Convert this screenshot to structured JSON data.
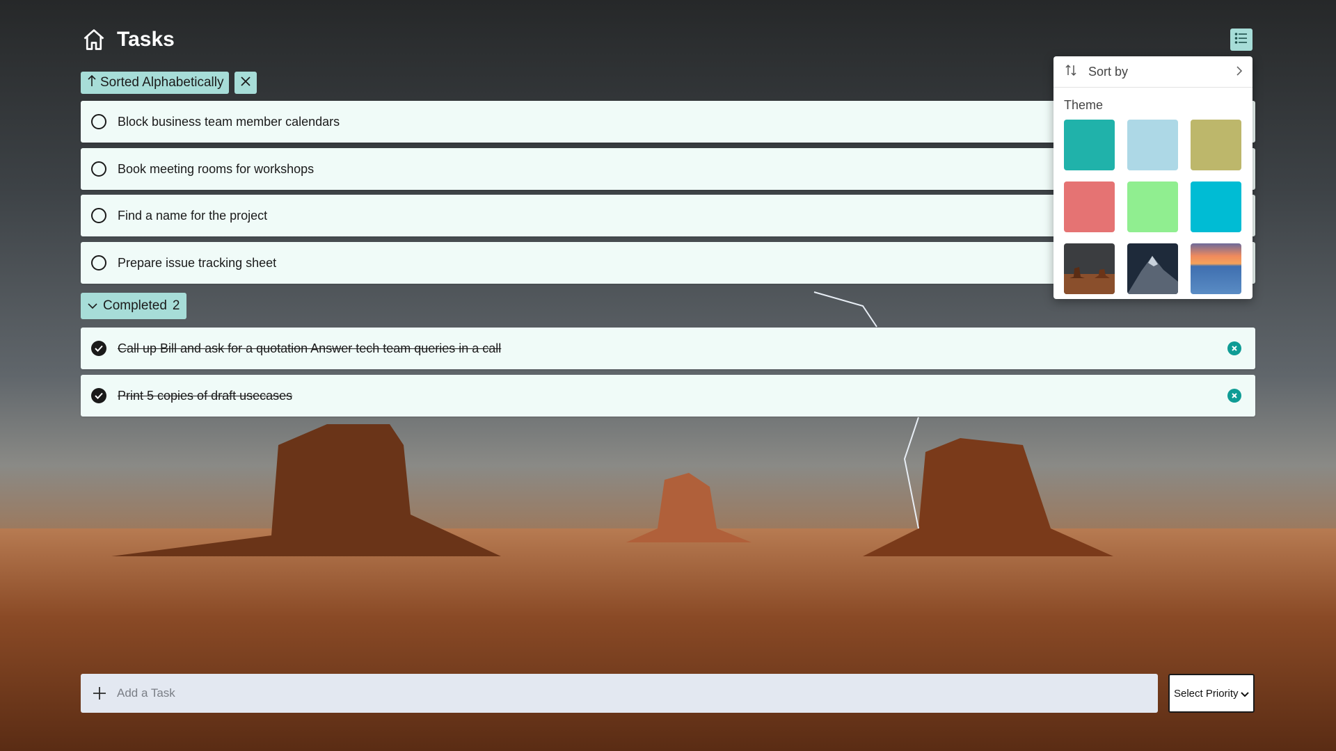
{
  "app": {
    "title": "Tasks"
  },
  "sort": {
    "label": "Sorted Alphabetically"
  },
  "tasks": [
    {
      "label": "Block business team member calendars"
    },
    {
      "label": "Book meeting rooms for workshops"
    },
    {
      "label": "Find a name for the project"
    },
    {
      "label": "Prepare issue tracking sheet"
    }
  ],
  "completed": {
    "label": "Completed",
    "count": "2",
    "items": [
      {
        "label": "Call up Bill and ask for a quotation Answer tech team queries in a call"
      },
      {
        "label": "Print 5 copies of draft usecases"
      }
    ]
  },
  "menu": {
    "sort_by": "Sort by",
    "theme_label": "Theme",
    "theme_colors": [
      "#20b2aa",
      "#add8e6",
      "#bdb76b",
      "#e57373",
      "#90ee90",
      "#00bcd4"
    ],
    "theme_images": [
      "desert-buttes-thumbnail",
      "mountain-night-thumbnail",
      "sunset-ocean-thumbnail"
    ]
  },
  "add_task": {
    "placeholder": "Add a Task"
  },
  "priority": {
    "selected": "Select Priority"
  },
  "colors": {
    "accent": "#a7ddd8",
    "task_bg": "#f0fbf8",
    "remove_icon": "#0f9c95",
    "input_bg": "#e3e8f1"
  }
}
